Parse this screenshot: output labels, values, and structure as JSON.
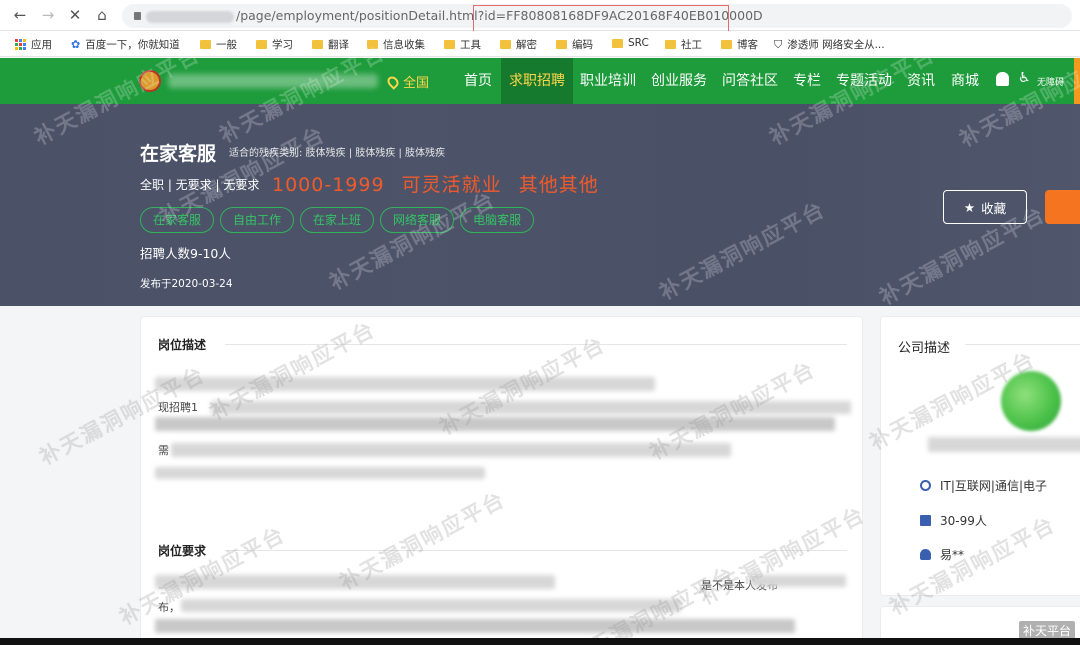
{
  "browser": {
    "url_path": "/page/employment/positionDetail.html?id=FF80808168DF9AC20168F40EB010000D",
    "bookmarks": [
      {
        "label": "应用",
        "icon": "apps-icon"
      },
      {
        "label": "百度一下，你就知道",
        "icon": "baidu-paw-icon"
      },
      {
        "label": "一般",
        "icon": "folder-icon"
      },
      {
        "label": "学习",
        "icon": "folder-icon"
      },
      {
        "label": "翻译",
        "icon": "folder-icon"
      },
      {
        "label": "信息收集",
        "icon": "folder-icon"
      },
      {
        "label": "工具",
        "icon": "folder-icon"
      },
      {
        "label": "解密",
        "icon": "folder-icon"
      },
      {
        "label": "编码",
        "icon": "folder-icon"
      },
      {
        "label": "SRC",
        "icon": "folder-icon"
      },
      {
        "label": "社工",
        "icon": "folder-icon"
      },
      {
        "label": "博客",
        "icon": "folder-icon"
      },
      {
        "label": "渗透师 网络安全从...",
        "icon": "shield-icon"
      }
    ]
  },
  "site_nav": {
    "location": "全国",
    "items": [
      "首页",
      "求职招聘",
      "职业培训",
      "创业服务",
      "问答社区",
      "专栏",
      "专题活动",
      "资讯",
      "商城"
    ],
    "active_index": 1,
    "accessibility": "无障碍"
  },
  "job": {
    "title": "在家客服",
    "disability_types": "适合的残疾类别: 肢体残疾 | 肢体残疾 | 肢体残疾",
    "meta": "全职 | 无要求 | 无要求",
    "salary": "1000-1999",
    "mode": "可灵活就业",
    "other": "其他其他",
    "tags": [
      "在家客服",
      "自由工作",
      "在家上班",
      "网络客服",
      "电脑客服"
    ],
    "recruit_count": "招聘人数9-10人",
    "published": "发布于2020-03-24",
    "favorite_label": "收藏"
  },
  "description": {
    "title": "岗位描述",
    "fragment_1": "现招聘1",
    "fragment_2": "需"
  },
  "requirements": {
    "title": "岗位要求",
    "fragment_1": "是不是本人发布",
    "fragment_2": "布，"
  },
  "company": {
    "title": "公司描述",
    "industry": "IT|互联网|通信|电子",
    "size": "30-99人",
    "contact": "易**"
  },
  "watermark": "补天漏洞响应平台",
  "corner_watermark": "补天平台",
  "colors": {
    "nav_green": "#1e9b3b",
    "active_tab": "#167a2e",
    "salary_orange": "#f05a2a",
    "tag_green": "#35c465",
    "hero_bg": "#4b5268"
  }
}
